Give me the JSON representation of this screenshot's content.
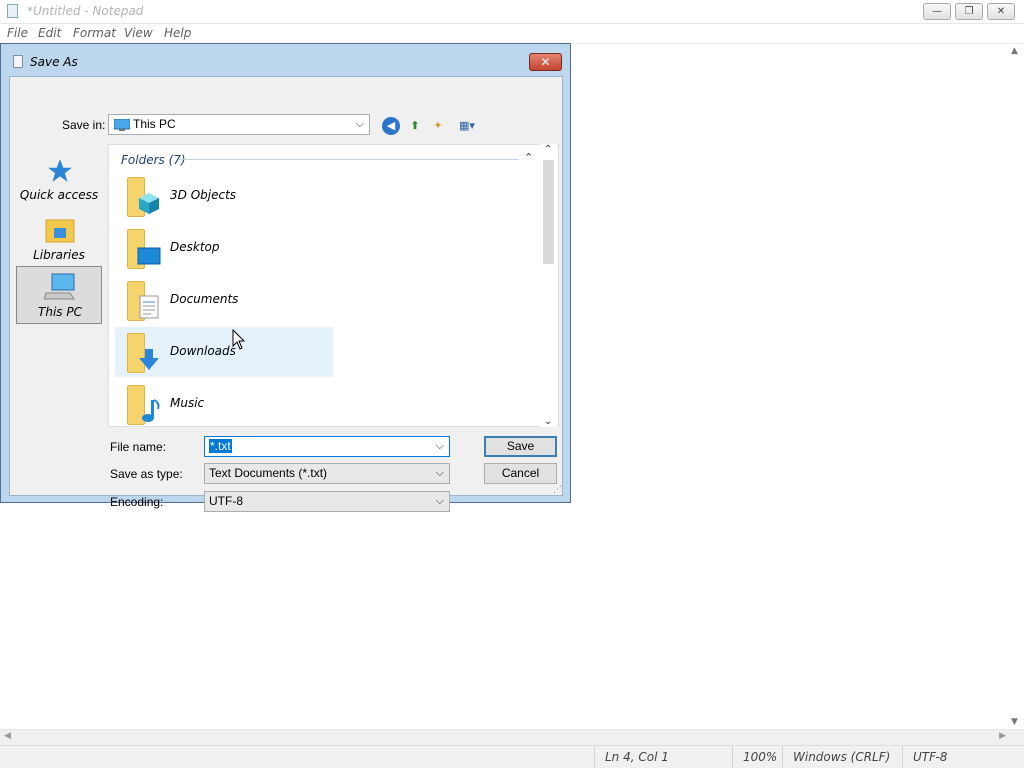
{
  "notepad": {
    "title": "*Untitled - Notepad",
    "menu": [
      "File",
      "Edit",
      "Format",
      "View",
      "Help"
    ],
    "window_buttons": {
      "minimize": "—",
      "restore": "❐",
      "close": "✕"
    },
    "status": {
      "position": "Ln 4, Col 1",
      "zoom": "100%",
      "line_ending": "Windows (CRLF)",
      "encoding": "UTF-8"
    }
  },
  "dialog": {
    "title": "Save As",
    "close_glyph": "✕",
    "save_in": {
      "label": "Save in:",
      "value": "This PC"
    },
    "places": [
      {
        "label": "Quick access",
        "icon": "star-icon"
      },
      {
        "label": "Libraries",
        "icon": "libraries-icon"
      },
      {
        "label": "This PC",
        "icon": "computer-icon",
        "selected": true
      }
    ],
    "group": {
      "label": "Folders (7)"
    },
    "folders": [
      {
        "name": "3D Objects",
        "icon": "cube-icon"
      },
      {
        "name": "Desktop",
        "icon": "desktop-icon"
      },
      {
        "name": "Documents",
        "icon": "document-icon"
      },
      {
        "name": "Downloads",
        "icon": "download-arrow-icon",
        "hovered": true
      },
      {
        "name": "Music",
        "icon": "music-note-icon"
      }
    ],
    "file_name": {
      "label": "File name:",
      "value": "*.txt"
    },
    "save_as_type": {
      "label": "Save as type:",
      "value": "Text Documents (*.txt)"
    },
    "encoding": {
      "label": "Encoding:",
      "value": "UTF-8"
    },
    "buttons": {
      "save": "Save",
      "cancel": "Cancel"
    }
  },
  "colors": {
    "accent": "#0078d7",
    "dialog_frame": "#bcd6ee",
    "close_red": "#c24633",
    "folder_yellow": "#f5d46e",
    "hover": "#e5f1fb"
  }
}
